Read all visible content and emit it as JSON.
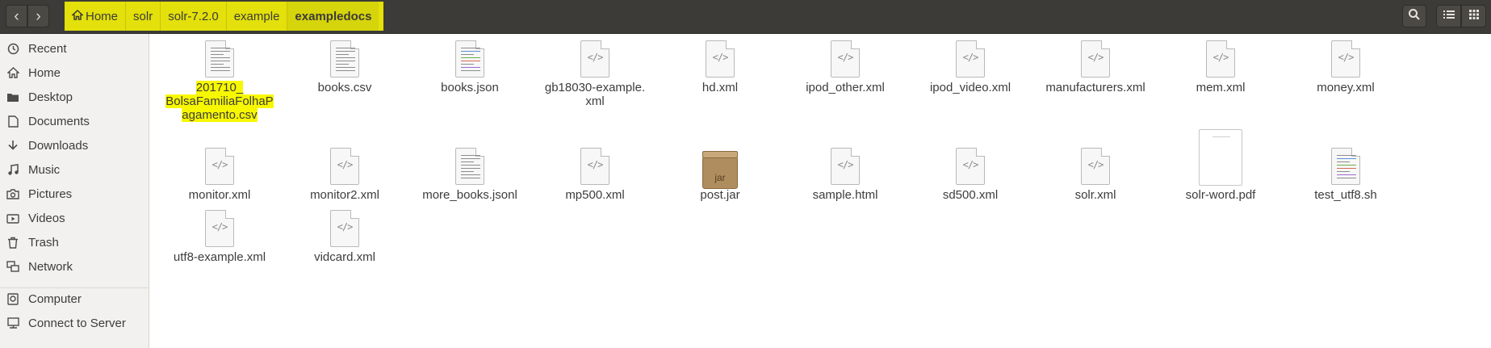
{
  "header": {
    "back_icon": "chevron-left-icon",
    "forward_icon": "chevron-right-icon",
    "breadcrumbs": [
      "Home",
      "solr",
      "solr-7.2.0",
      "example",
      "exampledocs"
    ],
    "search_icon": "search-icon",
    "list_view_icon": "list-view-icon",
    "grid_view_icon": "grid-view-icon",
    "highlight_color": "#e3e00b"
  },
  "sidebar": {
    "items": [
      {
        "label": "Recent",
        "icon": "clock-icon"
      },
      {
        "label": "Home",
        "icon": "home-icon"
      },
      {
        "label": "Desktop",
        "icon": "folder-icon"
      },
      {
        "label": "Documents",
        "icon": "document-icon"
      },
      {
        "label": "Downloads",
        "icon": "download-icon"
      },
      {
        "label": "Music",
        "icon": "music-icon"
      },
      {
        "label": "Pictures",
        "icon": "camera-icon"
      },
      {
        "label": "Videos",
        "icon": "video-icon"
      },
      {
        "label": "Trash",
        "icon": "trash-icon"
      },
      {
        "label": "Network",
        "icon": "network-icon"
      },
      {
        "label": "Computer",
        "icon": "computer-icon"
      },
      {
        "label": "Connect to Server",
        "icon": "server-icon"
      }
    ]
  },
  "files": [
    {
      "name_lines": [
        "201710_",
        "BolsaFamiliaFolhaP",
        "agamento.csv"
      ],
      "type": "text",
      "highlighted": true
    },
    {
      "name_lines": [
        "books.csv"
      ],
      "type": "text"
    },
    {
      "name_lines": [
        "books.json"
      ],
      "type": "colortext"
    },
    {
      "name_lines": [
        "gb18030-example.",
        "xml"
      ],
      "type": "code"
    },
    {
      "name_lines": [
        "hd.xml"
      ],
      "type": "code"
    },
    {
      "name_lines": [
        "ipod_other.xml"
      ],
      "type": "code"
    },
    {
      "name_lines": [
        "ipod_video.xml"
      ],
      "type": "code"
    },
    {
      "name_lines": [
        "manufacturers.xml"
      ],
      "type": "code"
    },
    {
      "name_lines": [
        "mem.xml"
      ],
      "type": "code"
    },
    {
      "name_lines": [
        "money.xml"
      ],
      "type": "code"
    },
    {
      "name_lines": [
        "monitor.xml"
      ],
      "type": "code"
    },
    {
      "name_lines": [
        "monitor2.xml"
      ],
      "type": "code"
    },
    {
      "name_lines": [
        "more_books.jsonl"
      ],
      "type": "text"
    },
    {
      "name_lines": [
        "mp500.xml"
      ],
      "type": "code"
    },
    {
      "name_lines": [
        "post.jar"
      ],
      "type": "jar",
      "icon_text": "jar"
    },
    {
      "name_lines": [
        "sample.html"
      ],
      "type": "code"
    },
    {
      "name_lines": [
        "sd500.xml"
      ],
      "type": "code"
    },
    {
      "name_lines": [
        "solr.xml"
      ],
      "type": "code"
    },
    {
      "name_lines": [
        "solr-word.pdf"
      ],
      "type": "pdf"
    },
    {
      "name_lines": [
        "test_utf8.sh"
      ],
      "type": "colortext"
    },
    {
      "name_lines": [
        "utf8-example.xml"
      ],
      "type": "code"
    },
    {
      "name_lines": [
        "vidcard.xml"
      ],
      "type": "code"
    }
  ],
  "code_glyph": "</>"
}
